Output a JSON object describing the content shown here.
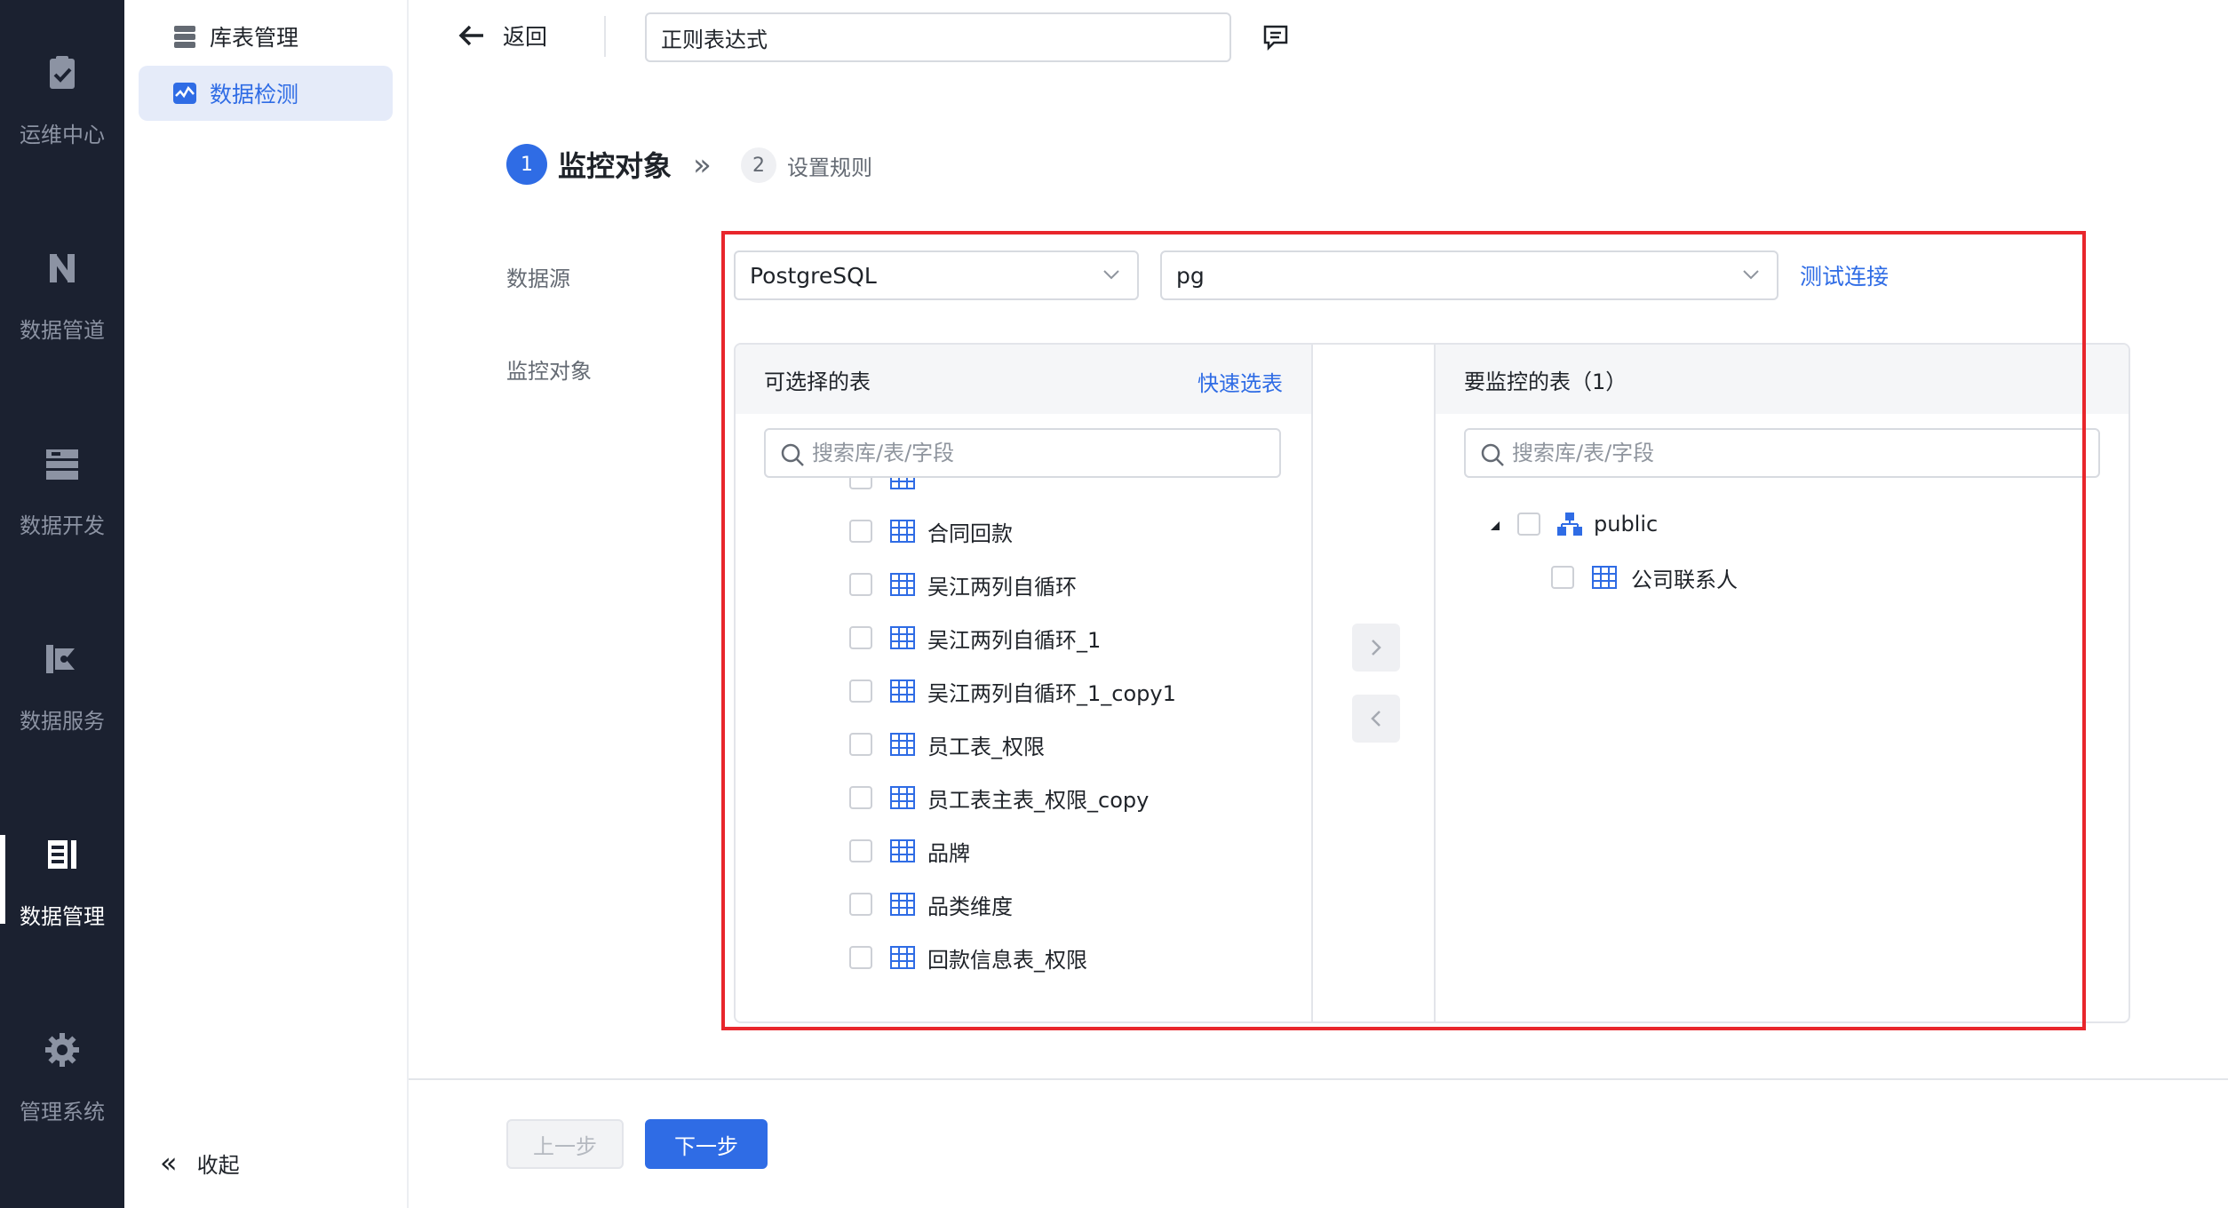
{
  "rail": {
    "items": [
      {
        "label": "运维中心",
        "icon": "clipboard-check-icon"
      },
      {
        "label": "数据管道",
        "icon": "pipeline-icon"
      },
      {
        "label": "数据开发",
        "icon": "server-stack-icon"
      },
      {
        "label": "数据服务",
        "icon": "service-icon"
      },
      {
        "label": "数据管理",
        "icon": "data-manage-icon",
        "active": true
      },
      {
        "label": "管理系统",
        "icon": "gear-icon"
      }
    ]
  },
  "sidebar": {
    "items": [
      {
        "label": "库表管理",
        "icon": "database-icon"
      },
      {
        "label": "数据检测",
        "icon": "monitor-chart-icon",
        "active": true
      }
    ],
    "collapse_label": "收起"
  },
  "topbar": {
    "back_label": "返回",
    "name_value": "正则表达式"
  },
  "steps": [
    {
      "num": "1",
      "label": "监控对象",
      "active": true
    },
    {
      "num": "2",
      "label": "设置规则",
      "active": false
    }
  ],
  "form": {
    "datasource_label": "数据源",
    "monitor_label": "监控对象",
    "db_type": "PostgreSQL",
    "db_name": "pg",
    "test_link": "测试连接"
  },
  "transfer": {
    "left": {
      "title": "可选择的表",
      "quick_select": "快速选表",
      "search_placeholder": "搜索库/表/字段",
      "items": [
        "合同回款",
        "吴江两列自循环",
        "吴江两列自循环_1",
        "吴江两列自循环_1_copy1",
        "员工表_权限",
        "员工表主表_权限_copy",
        "品牌",
        "品类维度",
        "回款信息表_权限"
      ]
    },
    "right": {
      "title": "要监控的表（1）",
      "search_placeholder": "搜索库/表/字段",
      "schema": "public",
      "items": [
        "公司联系人"
      ]
    }
  },
  "footer": {
    "prev_label": "上一步",
    "next_label": "下一步"
  },
  "colors": {
    "accent": "#2f6ce5",
    "rail_bg": "#1b2130",
    "highlight": "#e8262c"
  }
}
